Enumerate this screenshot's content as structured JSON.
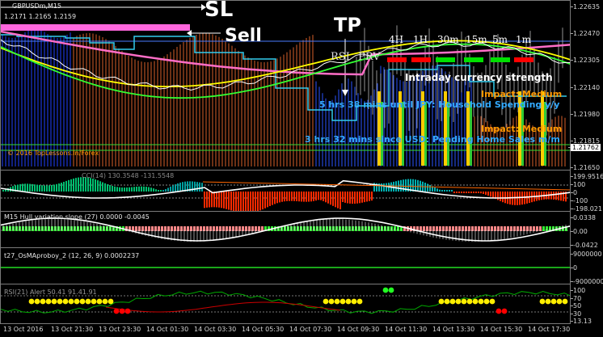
{
  "main": {
    "symbol": "GBPUSDm,M15",
    "prices_line": "1.2171  1.2165  1.2159",
    "sl_label": "SL",
    "sell_label": "Sell",
    "tp_label": "TP",
    "rsi_label": "RSI",
    "prv_label": "PRV",
    "timeframes": [
      "4H",
      "1H",
      "30m",
      "15m",
      "5m",
      "1m"
    ],
    "tf_colors": [
      "#ff0000",
      "#ff0000",
      "#00e000",
      "#00e000",
      "#00e000",
      "#ff0000"
    ],
    "strength_title": "Intraday currency strength",
    "impact1": "Impact: Medium",
    "news1": "5 hrs 38 mins until JPY: Household Spending y/y",
    "impact2": "Impact: Medium",
    "news2": "3 hrs 32 mins since USD: Pending Home Sales m/m",
    "copyright": "© 2016 TopLessons.In/Forex",
    "current_price": "1.21762",
    "price_ticks": [
      "1.22635",
      "1.22470",
      "1.22305",
      "1.22140",
      "1.21980",
      "1.21815",
      "1.21650"
    ]
  },
  "pane2": {
    "label": "CCI(14) 130.3548  -131.5548",
    "ticks": [
      "199.9516",
      "100",
      "0",
      "-100",
      "-198.021"
    ]
  },
  "pane3": {
    "label": "M15 Hull variation slope (27) 0.0000 -0.0045",
    "ticks": [
      "0.0338",
      "0.00",
      "-0.0422"
    ]
  },
  "pane4": {
    "label": "t27_OsMAproboy_2 (12, 26, 9) 0.0002237",
    "ticks": [
      "9000000",
      "0",
      "-9000000"
    ]
  },
  "pane5": {
    "label": "RSI(21) Alert 50.41 91.41.91",
    "ticks": [
      "100",
      "70",
      "50",
      "30",
      "13.13"
    ]
  },
  "xaxis": [
    "13 Oct 2016",
    "13 Oct 21:30",
    "13 Oct 23:30",
    "14 Oct 01:30",
    "14 Oct 03:30",
    "14 Oct 05:30",
    "14 Oct 07:30",
    "14 Oct 09:30",
    "14 Oct 11:30",
    "14 Oct 13:30",
    "14 Oct 15:30",
    "14 Oct 17:30"
  ],
  "colors": {
    "bull": "#00c000",
    "bear": "#ff2a00",
    "pink_line": "#ff6ec7",
    "cyan_line": "#33ccee",
    "yellow_line": "#ffff00",
    "green_line": "#33ff33",
    "dot_yellow": "#ffee00",
    "dot_red": "#ff0000",
    "dot_green": "#22ff22"
  }
}
